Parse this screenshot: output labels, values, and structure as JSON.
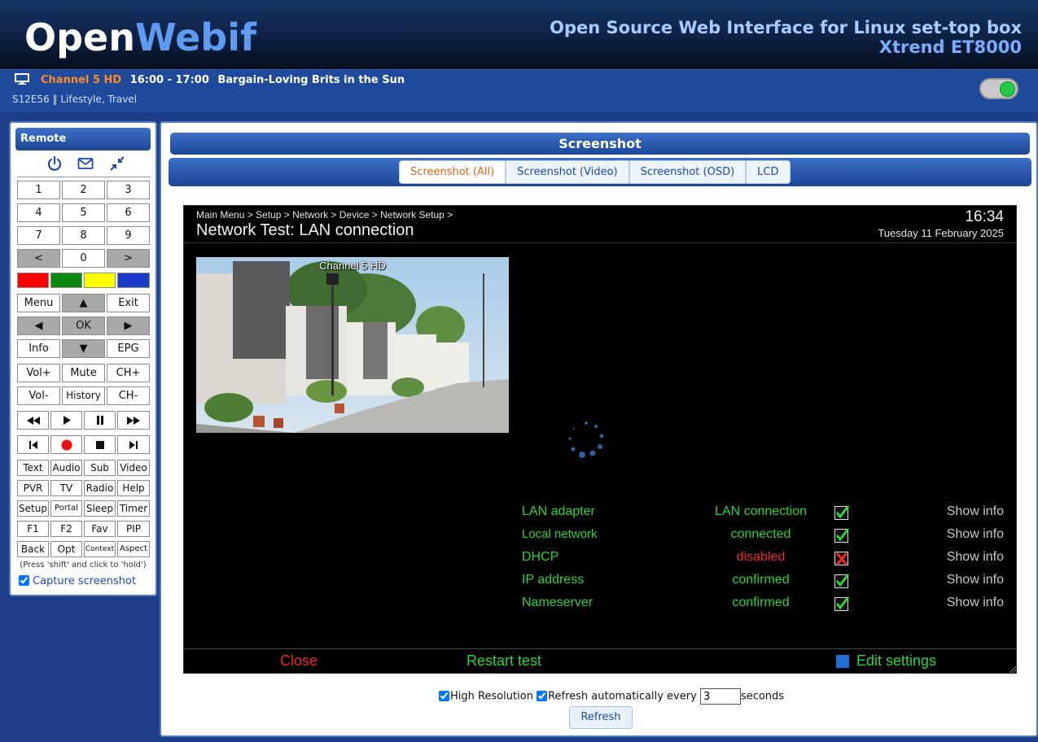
{
  "header": {
    "logo_open": "Open",
    "logo_webif": "Webif",
    "tagline": "Open Source Web Interface for Linux set-top box",
    "model": "Xtrend ET8000"
  },
  "now_playing": {
    "channel": "Channel 5 HD",
    "time": "16:00 - 17:00",
    "title": "Bargain-Loving Brits in the Sun",
    "details": "S12E56 ‖ Lifestyle, Travel",
    "toggle_state": "on"
  },
  "remote": {
    "title": "Remote",
    "icons": [
      "power-icon",
      "envelope-icon",
      "collapse-icon"
    ],
    "keys": {
      "k1": "1",
      "k2": "2",
      "k3": "3",
      "k4": "4",
      "k5": "5",
      "k6": "6",
      "k7": "7",
      "k8": "8",
      "k9": "9",
      "prev": "<",
      "k0": "0",
      "next": ">",
      "menu": "Menu",
      "up": "▲",
      "exit": "Exit",
      "left": "◀",
      "ok": "OK",
      "right": "▶",
      "info": "Info",
      "down": "▼",
      "epg": "EPG",
      "volup": "Vol+",
      "mute": "Mute",
      "chup": "CH+",
      "voldown": "Vol-",
      "history": "History",
      "chdown": "CH-",
      "text": "Text",
      "audio": "Audio",
      "sub": "Sub",
      "video": "Video",
      "pvr": "PVR",
      "tv": "TV",
      "radio": "Radio",
      "help": "Help",
      "setup": "Setup",
      "portal": "Portal",
      "sleep": "Sleep",
      "timer": "Timer",
      "f1": "F1",
      "f2": "F2",
      "fav": "Fav",
      "pip": "PIP",
      "back": "Back",
      "opt": "Opt",
      "context": "Context",
      "aspect": "Aspect"
    },
    "color_keys": [
      "#ff0000",
      "#0a8a12",
      "#ffff00",
      "#1a3cc8"
    ],
    "hold_note": "(Press 'shift' and click to 'hold')",
    "capture_label": "Capture screenshot",
    "capture_checked": true
  },
  "main": {
    "title": "Screenshot",
    "tabs": [
      {
        "label": "Screenshot (All)",
        "active": true
      },
      {
        "label": "Screenshot (Video)",
        "active": false
      },
      {
        "label": "Screenshot (OSD)",
        "active": false
      },
      {
        "label": "LCD",
        "active": false
      }
    ]
  },
  "screen": {
    "breadcrumb": "Main Menu > Setup > Network > Device > Network Setup >",
    "title": "Network Test: LAN connection",
    "time": "16:34",
    "date": "Tuesday 11 February 2025",
    "video_label": "Channel 5 HD",
    "rows": [
      {
        "name": "LAN adapter",
        "status": "LAN connection",
        "ok": true,
        "info": "Show info"
      },
      {
        "name": "Local network",
        "status": "connected",
        "ok": true,
        "info": "Show info"
      },
      {
        "name": "DHCP",
        "status": "disabled",
        "ok": false,
        "info": "Show info"
      },
      {
        "name": "IP address",
        "status": "confirmed",
        "ok": true,
        "info": "Show info"
      },
      {
        "name": "Nameserver",
        "status": "confirmed",
        "ok": true,
        "info": "Show info"
      }
    ],
    "buttons": {
      "close": "Close",
      "restart": "Restart test",
      "edit": "Edit settings"
    }
  },
  "options": {
    "high_res_label": "High Resolution",
    "high_res_checked": true,
    "refresh_label": "Refresh automatically every",
    "refresh_checked": true,
    "interval": "3",
    "seconds_label": "seconds",
    "refresh_button": "Refresh"
  },
  "colors": {
    "accent_orange": "#e0651a",
    "osd_green": "#2fd43a",
    "osd_red": "#ee2a2a",
    "panel_blue": "#1b4696"
  }
}
